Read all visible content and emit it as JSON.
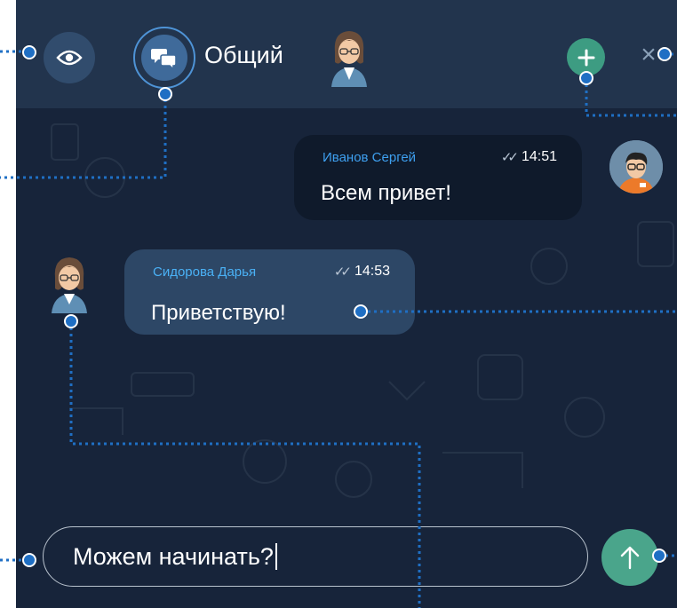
{
  "header": {
    "chat_title": "Общий",
    "icons": {
      "eye": "eye-icon",
      "chat": "chat-bubbles-icon",
      "add": "plus-icon",
      "close": "close-icon",
      "avatar": "user-avatar"
    }
  },
  "messages": [
    {
      "sender": "Иванов Сергей",
      "time": "14:51",
      "text": "Всем привет!",
      "status": "read-double-check"
    },
    {
      "sender": "Сидорова Дарья",
      "time": "14:53",
      "text": "Приветствую!",
      "status": "read-double-check"
    }
  ],
  "composer": {
    "value": "Можем начинать?",
    "send_icon": "arrow-up-icon"
  },
  "colors": {
    "header": "#22344d",
    "background": "#17243a",
    "accent": "#3d9c82",
    "annotation": "#1f6fc4"
  }
}
